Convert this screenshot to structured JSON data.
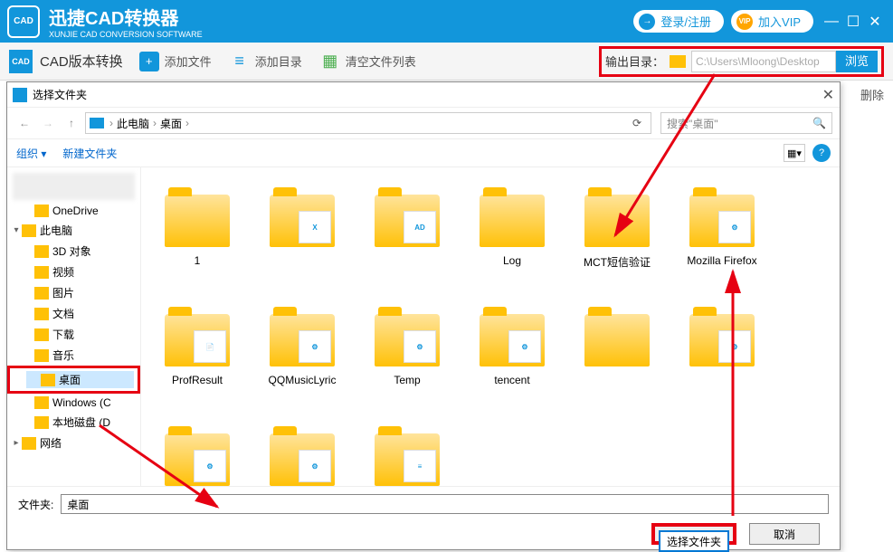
{
  "app": {
    "title": "迅捷CAD转换器",
    "subtitle": "XUNJIE CAD CONVERSION SOFTWARE",
    "logo_text": "CAD",
    "login": "登录/注册",
    "vip": "加入VIP",
    "vip_badge": "VIP"
  },
  "toolbar": {
    "section": "CAD版本转换",
    "add_file": "添加文件",
    "add_dir": "添加目录",
    "clear": "清空文件列表",
    "out_label": "输出目录：",
    "out_path": "C:\\Users\\Mloong\\Desktop",
    "browse": "浏览",
    "delete": "删除"
  },
  "dialog": {
    "title": "选择文件夹",
    "breadcrumb": {
      "pc": "此电脑",
      "desktop": "桌面"
    },
    "search_placeholder": "搜索\"桌面\"",
    "organize": "组织",
    "new_folder": "新建文件夹",
    "folder_label": "文件夹:",
    "folder_value": "桌面",
    "select_btn": "选择文件夹",
    "cancel_btn": "取消"
  },
  "tree": [
    {
      "label": "OneDrive",
      "icon": "cloud",
      "indent": 1
    },
    {
      "label": "此电脑",
      "icon": "pc",
      "indent": 0,
      "exp": "▾"
    },
    {
      "label": "3D 对象",
      "icon": "folder",
      "indent": 1
    },
    {
      "label": "视频",
      "icon": "folder",
      "indent": 1
    },
    {
      "label": "图片",
      "icon": "folder",
      "indent": 1
    },
    {
      "label": "文档",
      "icon": "folder",
      "indent": 1
    },
    {
      "label": "下载",
      "icon": "folder",
      "indent": 1
    },
    {
      "label": "音乐",
      "icon": "folder",
      "indent": 1
    },
    {
      "label": "桌面",
      "icon": "pc",
      "indent": 1,
      "selected": true
    },
    {
      "label": "Windows (C",
      "icon": "drive",
      "indent": 1
    },
    {
      "label": "本地磁盘 (D",
      "icon": "drive",
      "indent": 1
    },
    {
      "label": "网络",
      "icon": "folder",
      "indent": 0,
      "exp": "▸"
    }
  ],
  "folders": [
    {
      "label": "1",
      "thumb": ""
    },
    {
      "label": "",
      "thumb": "X"
    },
    {
      "label": "",
      "thumb": "AD"
    },
    {
      "label": "Log",
      "thumb": ""
    },
    {
      "label": "MCT短信验证",
      "thumb": ""
    },
    {
      "label": "Mozilla Firefox",
      "thumb": "⚙"
    },
    {
      "label": "ProfResult",
      "thumb": "📄"
    },
    {
      "label": "QQMusicLyric",
      "thumb": "⚙"
    },
    {
      "label": "Temp",
      "thumb": "⚙"
    },
    {
      "label": "tencent",
      "thumb": "⚙"
    },
    {
      "label": "",
      "thumb": ""
    },
    {
      "label": "",
      "thumb": "⚙"
    },
    {
      "label": "",
      "thumb": "⚙"
    },
    {
      "label": "",
      "thumb": "⚙"
    },
    {
      "label": "",
      "thumb": "≡"
    }
  ]
}
